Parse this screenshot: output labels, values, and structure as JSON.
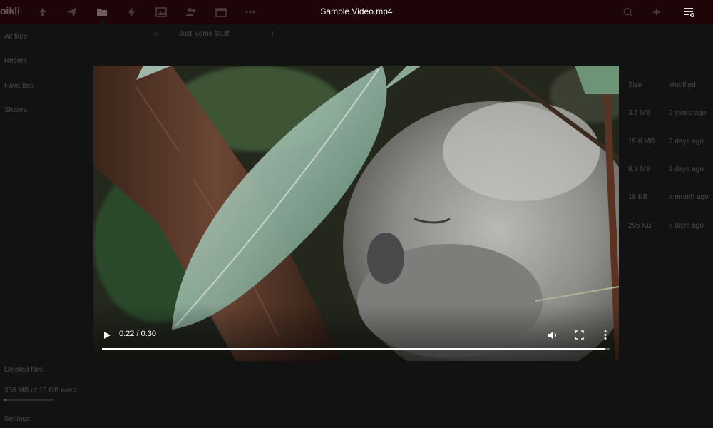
{
  "app": {
    "brand": "oikli",
    "window_title": "Sample Video.mp4"
  },
  "nav": {
    "icons": [
      "upload-icon",
      "send-icon",
      "folder-icon",
      "bolt-icon",
      "image-icon",
      "users-icon",
      "calendar-icon",
      "more-icon"
    ],
    "active": "folder-icon"
  },
  "header_right": {
    "icons": [
      "search-icon",
      "sparkle-icon",
      "sidebar-toggle-icon"
    ]
  },
  "sidebar": {
    "items": [
      {
        "label": "All files"
      },
      {
        "label": "Recent"
      },
      {
        "label": "Favorites"
      },
      {
        "label": "Shares"
      }
    ],
    "bottom": [
      {
        "label": "Deleted files"
      },
      {
        "label": "356 MB of 10 GB used"
      },
      {
        "label": "Settings"
      }
    ],
    "quota_fraction": 0.036
  },
  "breadcrumb": {
    "folder": "Just Some Stuff"
  },
  "file_table": {
    "columns": [
      "Size",
      "Modified"
    ],
    "rows": [
      {
        "size": "3.7 MB",
        "modified": "2 years ago"
      },
      {
        "size": "15.8 MB",
        "modified": "2 days ago"
      },
      {
        "size": "8.3 MB",
        "modified": "9 days ago"
      },
      {
        "size": "18 KB",
        "modified": "a month ago"
      },
      {
        "size": "295 KB",
        "modified": "6 days ago"
      }
    ]
  },
  "player": {
    "current_time": "0:22",
    "duration": "0:30",
    "time_display": "0:22 / 0:30",
    "progress_fraction": 0.99,
    "controls": [
      "play-icon",
      "volume-icon",
      "fullscreen-icon",
      "more-options-icon"
    ]
  },
  "colors": {
    "topbar": "#1e0507",
    "backdrop": "#121212"
  }
}
